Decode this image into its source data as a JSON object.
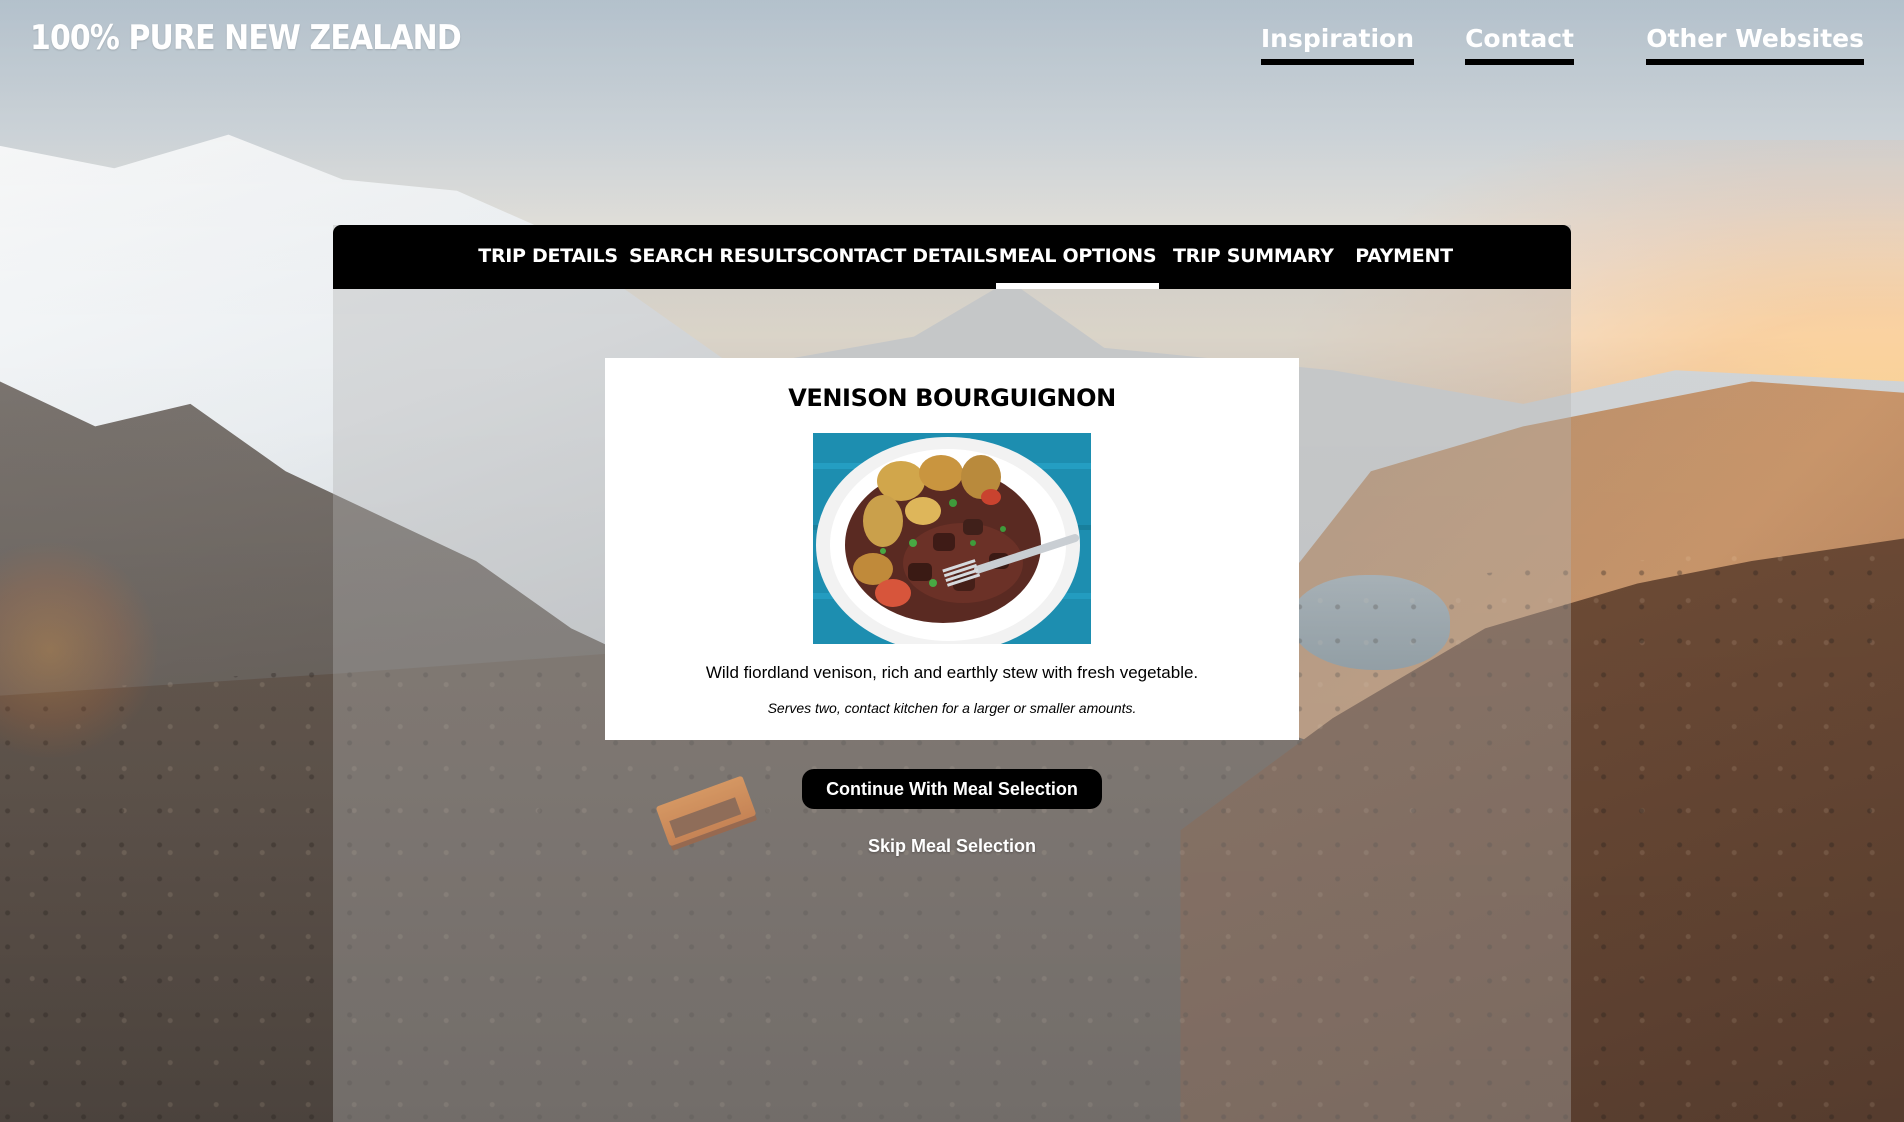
{
  "header": {
    "logo_text": "100% PURE NEW ZEALAND",
    "nav": [
      {
        "label": "Inspiration"
      },
      {
        "label": "Contact"
      },
      {
        "label": "Other Websites"
      }
    ]
  },
  "tabs": [
    {
      "label": "Trip Details",
      "active": false
    },
    {
      "label": "Search Results",
      "active": false
    },
    {
      "label": "Contact Details",
      "active": false
    },
    {
      "label": "Meal Options",
      "active": true
    },
    {
      "label": "Trip Summary",
      "active": false
    },
    {
      "label": "Payment",
      "active": false
    }
  ],
  "meal": {
    "title": "Venison Bourguignon",
    "description": "Wild fiordland venison, rich and earthly stew with fresh vegetable.",
    "note": "Serves two, contact kitchen for a larger or smaller amounts."
  },
  "actions": {
    "continue_label": "Continue With Meal Selection",
    "skip_label": "Skip Meal Selection"
  },
  "colors": {
    "tab_bar": "#000000",
    "active_underline": "#ffffff",
    "button_bg": "#000000",
    "text_light": "#ffffff"
  }
}
